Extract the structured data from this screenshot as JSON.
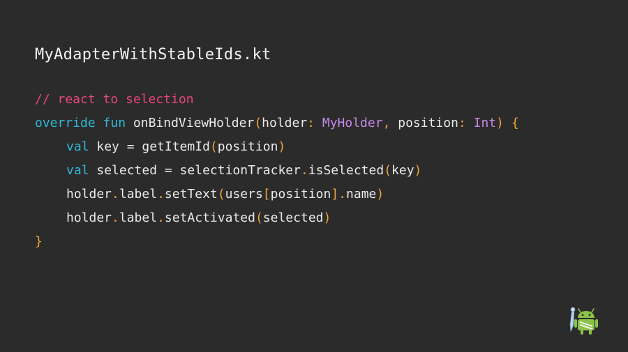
{
  "slide": {
    "filename": "MyAdapterWithStableIds.kt",
    "code_lines": [
      {
        "indent": false,
        "tokens": [
          {
            "t": "// react to selection",
            "k": "comment"
          }
        ]
      },
      {
        "indent": false,
        "tokens": [
          {
            "t": "override",
            "k": "kw"
          },
          {
            "t": " ",
            "k": "text"
          },
          {
            "t": "fun",
            "k": "kw"
          },
          {
            "t": " onBindViewHolder",
            "k": "text"
          },
          {
            "t": "(",
            "k": "punc"
          },
          {
            "t": "holder",
            "k": "text"
          },
          {
            "t": ":",
            "k": "punc"
          },
          {
            "t": " ",
            "k": "text"
          },
          {
            "t": "MyHolder",
            "k": "type"
          },
          {
            "t": ",",
            "k": "punc"
          },
          {
            "t": " position",
            "k": "text"
          },
          {
            "t": ":",
            "k": "punc"
          },
          {
            "t": " ",
            "k": "text"
          },
          {
            "t": "Int",
            "k": "type"
          },
          {
            "t": ")",
            "k": "punc"
          },
          {
            "t": " ",
            "k": "text"
          },
          {
            "t": "{",
            "k": "punc"
          }
        ]
      },
      {
        "indent": true,
        "tokens": [
          {
            "t": "val",
            "k": "kw"
          },
          {
            "t": " key = getItemId",
            "k": "text"
          },
          {
            "t": "(",
            "k": "punc"
          },
          {
            "t": "position",
            "k": "text"
          },
          {
            "t": ")",
            "k": "punc"
          }
        ]
      },
      {
        "indent": true,
        "tokens": [
          {
            "t": "val",
            "k": "kw"
          },
          {
            "t": " selected = selectionTracker",
            "k": "text"
          },
          {
            "t": ".",
            "k": "punc"
          },
          {
            "t": "isSelected",
            "k": "text"
          },
          {
            "t": "(",
            "k": "punc"
          },
          {
            "t": "key",
            "k": "text"
          },
          {
            "t": ")",
            "k": "punc"
          }
        ]
      },
      {
        "indent": true,
        "tokens": [
          {
            "t": "holder",
            "k": "text"
          },
          {
            "t": ".",
            "k": "punc"
          },
          {
            "t": "label",
            "k": "text"
          },
          {
            "t": ".",
            "k": "punc"
          },
          {
            "t": "setText",
            "k": "text"
          },
          {
            "t": "(",
            "k": "punc"
          },
          {
            "t": "users",
            "k": "text"
          },
          {
            "t": "[",
            "k": "punc"
          },
          {
            "t": "position",
            "k": "text"
          },
          {
            "t": "]",
            "k": "punc"
          },
          {
            "t": ".",
            "k": "punc"
          },
          {
            "t": "name",
            "k": "text"
          },
          {
            "t": ")",
            "k": "punc"
          }
        ]
      },
      {
        "indent": true,
        "tokens": [
          {
            "t": "holder",
            "k": "text"
          },
          {
            "t": ".",
            "k": "punc"
          },
          {
            "t": "label",
            "k": "text"
          },
          {
            "t": ".",
            "k": "punc"
          },
          {
            "t": "setActivated",
            "k": "text"
          },
          {
            "t": "(",
            "k": "punc"
          },
          {
            "t": "selected",
            "k": "text"
          },
          {
            "t": ")",
            "k": "punc"
          }
        ]
      },
      {
        "indent": false,
        "tokens": [
          {
            "t": "}",
            "k": "punc"
          }
        ]
      }
    ],
    "logo_icon": "android-studio-icon"
  },
  "colors": {
    "background": "#2b2b2b",
    "comment": "#e8457f",
    "keyword": "#31b8d6",
    "type": "#c689e8",
    "punctuation": "#f0a53a",
    "text": "#eaeaea"
  }
}
